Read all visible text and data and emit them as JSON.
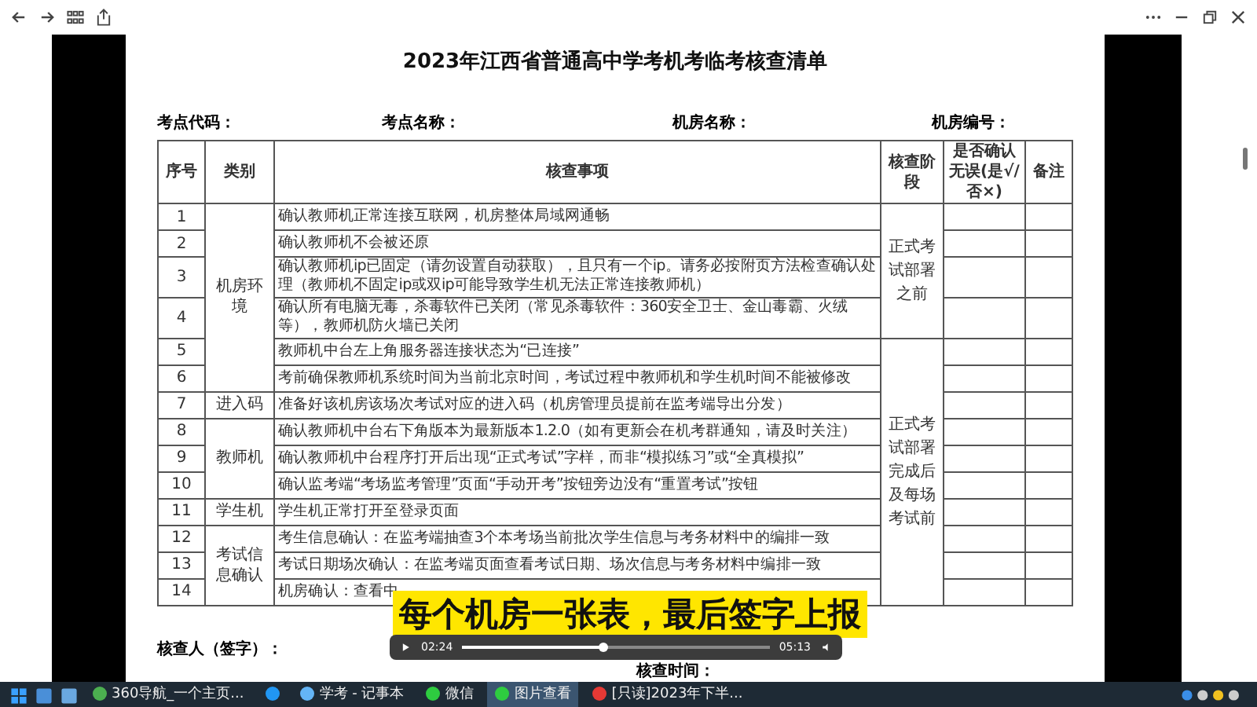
{
  "document": {
    "title": "2023年江西省普通高中学考机考临考核查清单",
    "fields": [
      "考点代码：",
      "考点名称：",
      "机房名称：",
      "机房编号："
    ],
    "columns": [
      "序号",
      "类别",
      "核查事项",
      "核查阶段",
      "是否确认无误(是√/否×)",
      "备注"
    ],
    "rows": [
      {
        "no": "1",
        "category": "机房环境",
        "stage": "正式考试部署之前",
        "text": "确认教师机正常连接互联网，机房整体局域网通畅"
      },
      {
        "no": "2",
        "text": "确认教师机不会被还原"
      },
      {
        "no": "3",
        "text": "确认教师机ip已固定（请勿设置自动获取），且只有一个ip。请务必按附页方法检查确认处理（教师机不固定ip或双ip可能导致学生机无法正常连接教师机）"
      },
      {
        "no": "4",
        "text": "确认所有电脑无毒，杀毒软件已关闭（常见杀毒软件：360安全卫士、金山毒霸、火绒等），教师机防火墙已关闭"
      },
      {
        "no": "5",
        "stage": "正式考试部署完成后及每场考试前",
        "text": "教师机中台左上角服务器连接状态为“已连接”"
      },
      {
        "no": "6",
        "text": "考前确保教师机系统时间为当前北京时间，考试过程中教师机和学生机时间不能被修改"
      },
      {
        "no": "7",
        "category": "进入码",
        "text": "准备好该机房该场次考试对应的进入码（机房管理员提前在监考端导出分发）"
      },
      {
        "no": "8",
        "category": "教师机",
        "text": "确认教师机中台右下角版本为最新版本1.2.0（如有更新会在机考群通知，请及时关注）"
      },
      {
        "no": "9",
        "text": "确认教师机中台程序打开后出现“正式考试”字样，而非“模拟练习”或“全真模拟”"
      },
      {
        "no": "10",
        "text": "确认监考端“考场监考管理”页面“手动开考”按钮旁边没有“重置考试”按钮"
      },
      {
        "no": "11",
        "category": "学生机",
        "text": "学生机正常打开至登录页面"
      },
      {
        "no": "12",
        "category": "考试信息确认",
        "text": "考生信息确认：在监考端抽查3个本考场当前批次学生信息与考务材料中的编排一致"
      },
      {
        "no": "13",
        "text": "考试日期场次确认：在监考端页面查看考试日期、场次信息与考务材料中编排一致"
      },
      {
        "no": "14",
        "text": "机房确认：查看中"
      }
    ],
    "footer": [
      "核查人（签字）：",
      "核查时间："
    ]
  },
  "subtitle": "每个机房一张表，最后签字上报",
  "player": {
    "current": "02:24",
    "duration": "05:13",
    "level": 0.46
  },
  "taskbar": [
    {
      "label": "360导航_一个主页...",
      "selected": false,
      "color": "#4caf50"
    },
    {
      "selected": false,
      "color": "#2196f3"
    },
    {
      "label": "学考 - 记事本",
      "selected": false,
      "color": "#64b5f6"
    },
    {
      "label": "微信",
      "selected": false,
      "color": "#2ecc40"
    },
    {
      "label": "图片查看",
      "selected": true,
      "color": "#2ecc40"
    },
    {
      "label": "[只读]2023年下半...",
      "selected": false,
      "color": "#e53935"
    }
  ]
}
